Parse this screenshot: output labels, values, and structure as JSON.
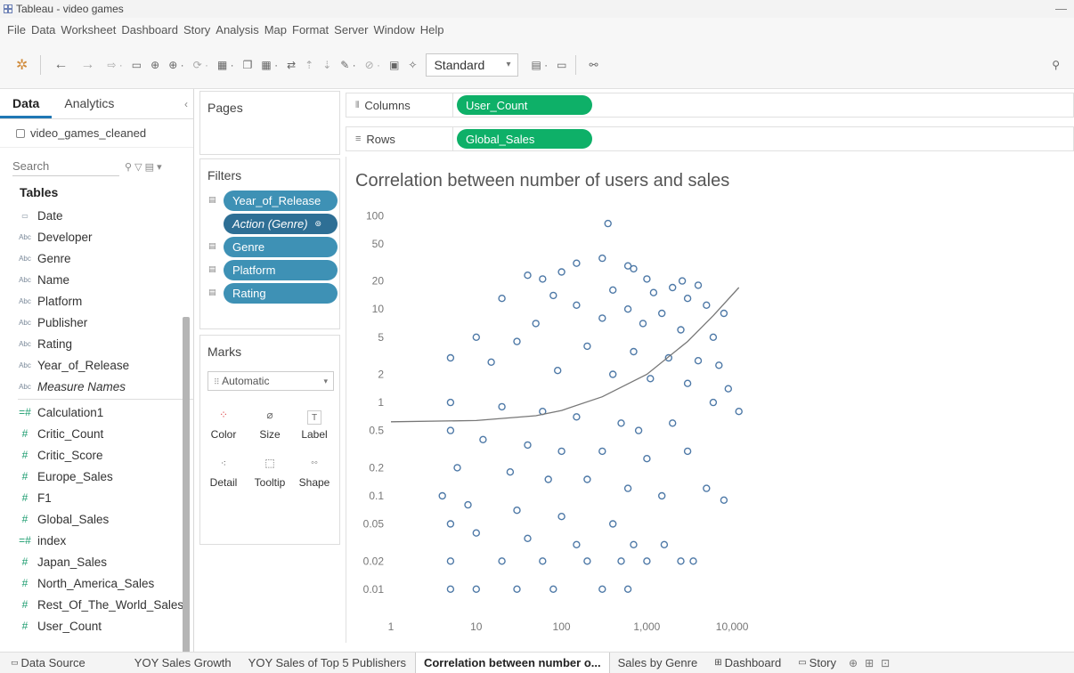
{
  "window": {
    "title": "Tableau - video games",
    "minimize": "—"
  },
  "menu": [
    "File",
    "Data",
    "Worksheet",
    "Dashboard",
    "Story",
    "Analysis",
    "Map",
    "Format",
    "Server",
    "Window",
    "Help"
  ],
  "toolbar": {
    "fit_select": "Standard"
  },
  "left_panel": {
    "tabs": [
      "Data",
      "Analytics"
    ],
    "collapse": "‹",
    "datasource": "video_games_cleaned",
    "search_placeholder": "Search",
    "tables_header": "Tables",
    "dimensions": [
      {
        "type": "date",
        "name": "Date"
      },
      {
        "type": "abc",
        "name": "Developer"
      },
      {
        "type": "abc",
        "name": "Genre"
      },
      {
        "type": "abc",
        "name": "Name"
      },
      {
        "type": "abc",
        "name": "Platform"
      },
      {
        "type": "abc",
        "name": "Publisher"
      },
      {
        "type": "abc",
        "name": "Rating"
      },
      {
        "type": "abc",
        "name": "Year_of_Release"
      },
      {
        "type": "abc",
        "name": "Measure Names"
      }
    ],
    "measures": [
      {
        "type": "calc",
        "name": "Calculation1"
      },
      {
        "type": "num",
        "name": "Critic_Count"
      },
      {
        "type": "num",
        "name": "Critic_Score"
      },
      {
        "type": "num",
        "name": "Europe_Sales"
      },
      {
        "type": "num",
        "name": "F1"
      },
      {
        "type": "num",
        "name": "Global_Sales"
      },
      {
        "type": "calc",
        "name": "index"
      },
      {
        "type": "num",
        "name": "Japan_Sales"
      },
      {
        "type": "num",
        "name": "North_America_Sales"
      },
      {
        "type": "num",
        "name": "Rest_Of_The_World_Sales"
      },
      {
        "type": "num",
        "name": "User_Count"
      }
    ]
  },
  "cards": {
    "pages_title": "Pages",
    "filters_title": "Filters",
    "filters": [
      "Year_of_Release",
      "Action (Genre)",
      "Genre",
      "Platform",
      "Rating"
    ],
    "marks_title": "Marks",
    "marks_type": "Automatic",
    "mark_buttons": [
      "Color",
      "Size",
      "Label",
      "Detail",
      "Tooltip",
      "Shape"
    ]
  },
  "shelves": {
    "columns_label": "Columns",
    "columns_pill": "User_Count",
    "rows_label": "Rows",
    "rows_pill": "Global_Sales"
  },
  "colors": {
    "accent_green": "#0eb068",
    "filter_blue": "#3e91b5",
    "mark_color": "#4e79a7"
  },
  "chart_data": {
    "type": "scatter",
    "title": "Correlation between number of users and sales",
    "x_scale": "log",
    "y_scale": "log",
    "xlim": [
      1,
      15000
    ],
    "ylim": [
      0.008,
      120
    ],
    "x_ticks": [
      {
        "v": 1,
        "label": "1"
      },
      {
        "v": 10,
        "label": "10"
      },
      {
        "v": 100,
        "label": "100"
      },
      {
        "v": 1000,
        "label": "1,000"
      },
      {
        "v": 10000,
        "label": "10,000"
      }
    ],
    "y_ticks": [
      {
        "v": 100,
        "label": "100"
      },
      {
        "v": 50,
        "label": "50"
      },
      {
        "v": 20,
        "label": "20"
      },
      {
        "v": 10,
        "label": "10"
      },
      {
        "v": 5,
        "label": "5"
      },
      {
        "v": 2,
        "label": "2"
      },
      {
        "v": 1,
        "label": "1"
      },
      {
        "v": 0.5,
        "label": "0.5"
      },
      {
        "v": 0.2,
        "label": "0.2"
      },
      {
        "v": 0.1,
        "label": "0.1"
      },
      {
        "v": 0.05,
        "label": "0.05"
      },
      {
        "v": 0.02,
        "label": "0.02"
      },
      {
        "v": 0.01,
        "label": "0.01"
      }
    ],
    "marker": "open-circle",
    "grid": false,
    "points": [
      [
        350,
        82.5
      ],
      [
        300,
        35
      ],
      [
        150,
        31
      ],
      [
        600,
        29
      ],
      [
        700,
        27
      ],
      [
        100,
        25
      ],
      [
        40,
        23
      ],
      [
        60,
        21
      ],
      [
        1000,
        21
      ],
      [
        2600,
        20
      ],
      [
        4000,
        18
      ],
      [
        2000,
        17
      ],
      [
        400,
        16
      ],
      [
        1200,
        15
      ],
      [
        80,
        14
      ],
      [
        20,
        13
      ],
      [
        3000,
        13
      ],
      [
        5000,
        11
      ],
      [
        8000,
        9
      ],
      [
        150,
        11
      ],
      [
        600,
        10
      ],
      [
        1500,
        9
      ],
      [
        300,
        8
      ],
      [
        50,
        7
      ],
      [
        900,
        7
      ],
      [
        2500,
        6
      ],
      [
        6000,
        5
      ],
      [
        10,
        5
      ],
      [
        30,
        4.5
      ],
      [
        200,
        4
      ],
      [
        700,
        3.5
      ],
      [
        1800,
        3
      ],
      [
        4000,
        2.8
      ],
      [
        7000,
        2.5
      ],
      [
        5,
        3
      ],
      [
        15,
        2.7
      ],
      [
        90,
        2.2
      ],
      [
        400,
        2
      ],
      [
        1100,
        1.8
      ],
      [
        3000,
        1.6
      ],
      [
        9000,
        1.4
      ],
      [
        6000,
        1
      ],
      [
        12000,
        0.8
      ],
      [
        2000,
        0.6
      ],
      [
        800,
        0.5
      ],
      [
        5,
        1
      ],
      [
        20,
        0.9
      ],
      [
        60,
        0.8
      ],
      [
        150,
        0.7
      ],
      [
        500,
        0.6
      ],
      [
        5,
        0.5
      ],
      [
        12,
        0.4
      ],
      [
        40,
        0.35
      ],
      [
        100,
        0.3
      ],
      [
        300,
        0.3
      ],
      [
        1000,
        0.25
      ],
      [
        3000,
        0.3
      ],
      [
        5000,
        0.12
      ],
      [
        8000,
        0.09
      ],
      [
        6,
        0.2
      ],
      [
        25,
        0.18
      ],
      [
        70,
        0.15
      ],
      [
        200,
        0.15
      ],
      [
        600,
        0.12
      ],
      [
        1500,
        0.1
      ],
      [
        4,
        0.1
      ],
      [
        8,
        0.08
      ],
      [
        30,
        0.07
      ],
      [
        100,
        0.06
      ],
      [
        400,
        0.05
      ],
      [
        5,
        0.05
      ],
      [
        10,
        0.04
      ],
      [
        40,
        0.035
      ],
      [
        150,
        0.03
      ],
      [
        700,
        0.03
      ],
      [
        1600,
        0.03
      ],
      [
        3500,
        0.02
      ],
      [
        2500,
        0.02
      ],
      [
        5,
        0.02
      ],
      [
        20,
        0.02
      ],
      [
        60,
        0.02
      ],
      [
        200,
        0.02
      ],
      [
        500,
        0.02
      ],
      [
        1000,
        0.02
      ],
      [
        5,
        0.01
      ],
      [
        10,
        0.01
      ],
      [
        30,
        0.01
      ],
      [
        80,
        0.01
      ],
      [
        300,
        0.01
      ],
      [
        600,
        0.01
      ]
    ],
    "trend_line": [
      [
        1,
        0.62
      ],
      [
        10,
        0.64
      ],
      [
        50,
        0.72
      ],
      [
        100,
        0.82
      ],
      [
        300,
        1.15
      ],
      [
        1000,
        2.0
      ],
      [
        3000,
        4.5
      ],
      [
        6000,
        8.5
      ],
      [
        12000,
        17
      ]
    ]
  },
  "bottom_tabs": {
    "data_source": "Data Source",
    "sheets": [
      "YOY Sales Growth",
      "YOY Sales of Top 5 Publishers",
      "Correlation between number o...",
      "Sales by Genre",
      "Dashboard",
      "Story"
    ],
    "active_index": 2
  }
}
